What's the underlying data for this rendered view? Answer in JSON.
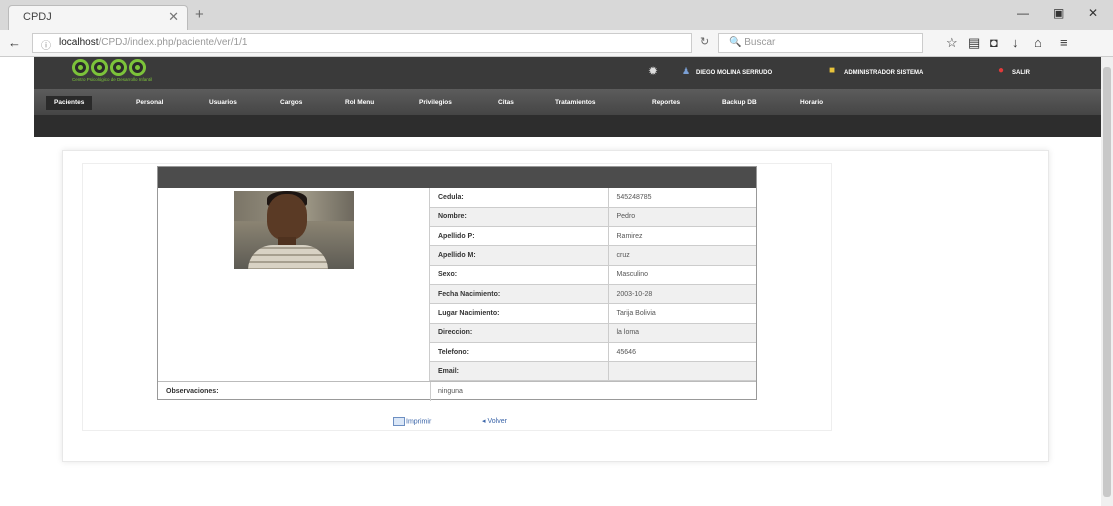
{
  "browser": {
    "tab_title": "CPDJ",
    "url_host": "localhost",
    "url_path": "/CPDJ/index.php/paciente/ver/1/1",
    "search_placeholder": "Buscar"
  },
  "app": {
    "logo_subtitle": "Centro Psicológico de Desarrollo Infantil",
    "user_name": "DIEGO MOLINA SERRUDO",
    "role": "ADMINISTRADOR SISTEMA",
    "logout": "SALIR",
    "menu": [
      "Pacientes",
      "Personal",
      "Usuarios",
      "Cargos",
      "Rol Menu",
      "Privilegios",
      "Citas",
      "Tratamientos",
      "Reportes",
      "Backup DB",
      "Horario"
    ]
  },
  "patient": {
    "rows": [
      {
        "label": "Cedula:",
        "value": "545248785"
      },
      {
        "label": "Nombre:",
        "value": "Pedro"
      },
      {
        "label": "Apellido P:",
        "value": "Ramirez"
      },
      {
        "label": "Apellido M:",
        "value": "cruz"
      },
      {
        "label": "Sexo:",
        "value": "Masculino"
      },
      {
        "label": "Fecha Nacimiento:",
        "value": "2003-10-28"
      },
      {
        "label": "Lugar Nacimiento:",
        "value": "Tarija Bolivia"
      },
      {
        "label": "Direccion:",
        "value": "la loma"
      },
      {
        "label": "Telefono:",
        "value": "45646"
      },
      {
        "label": "Email:",
        "value": ""
      }
    ],
    "observaciones_label": "Observaciones:",
    "observaciones_value": "ninguna"
  },
  "actions": {
    "print": "Imprimir",
    "back": "Volver"
  }
}
